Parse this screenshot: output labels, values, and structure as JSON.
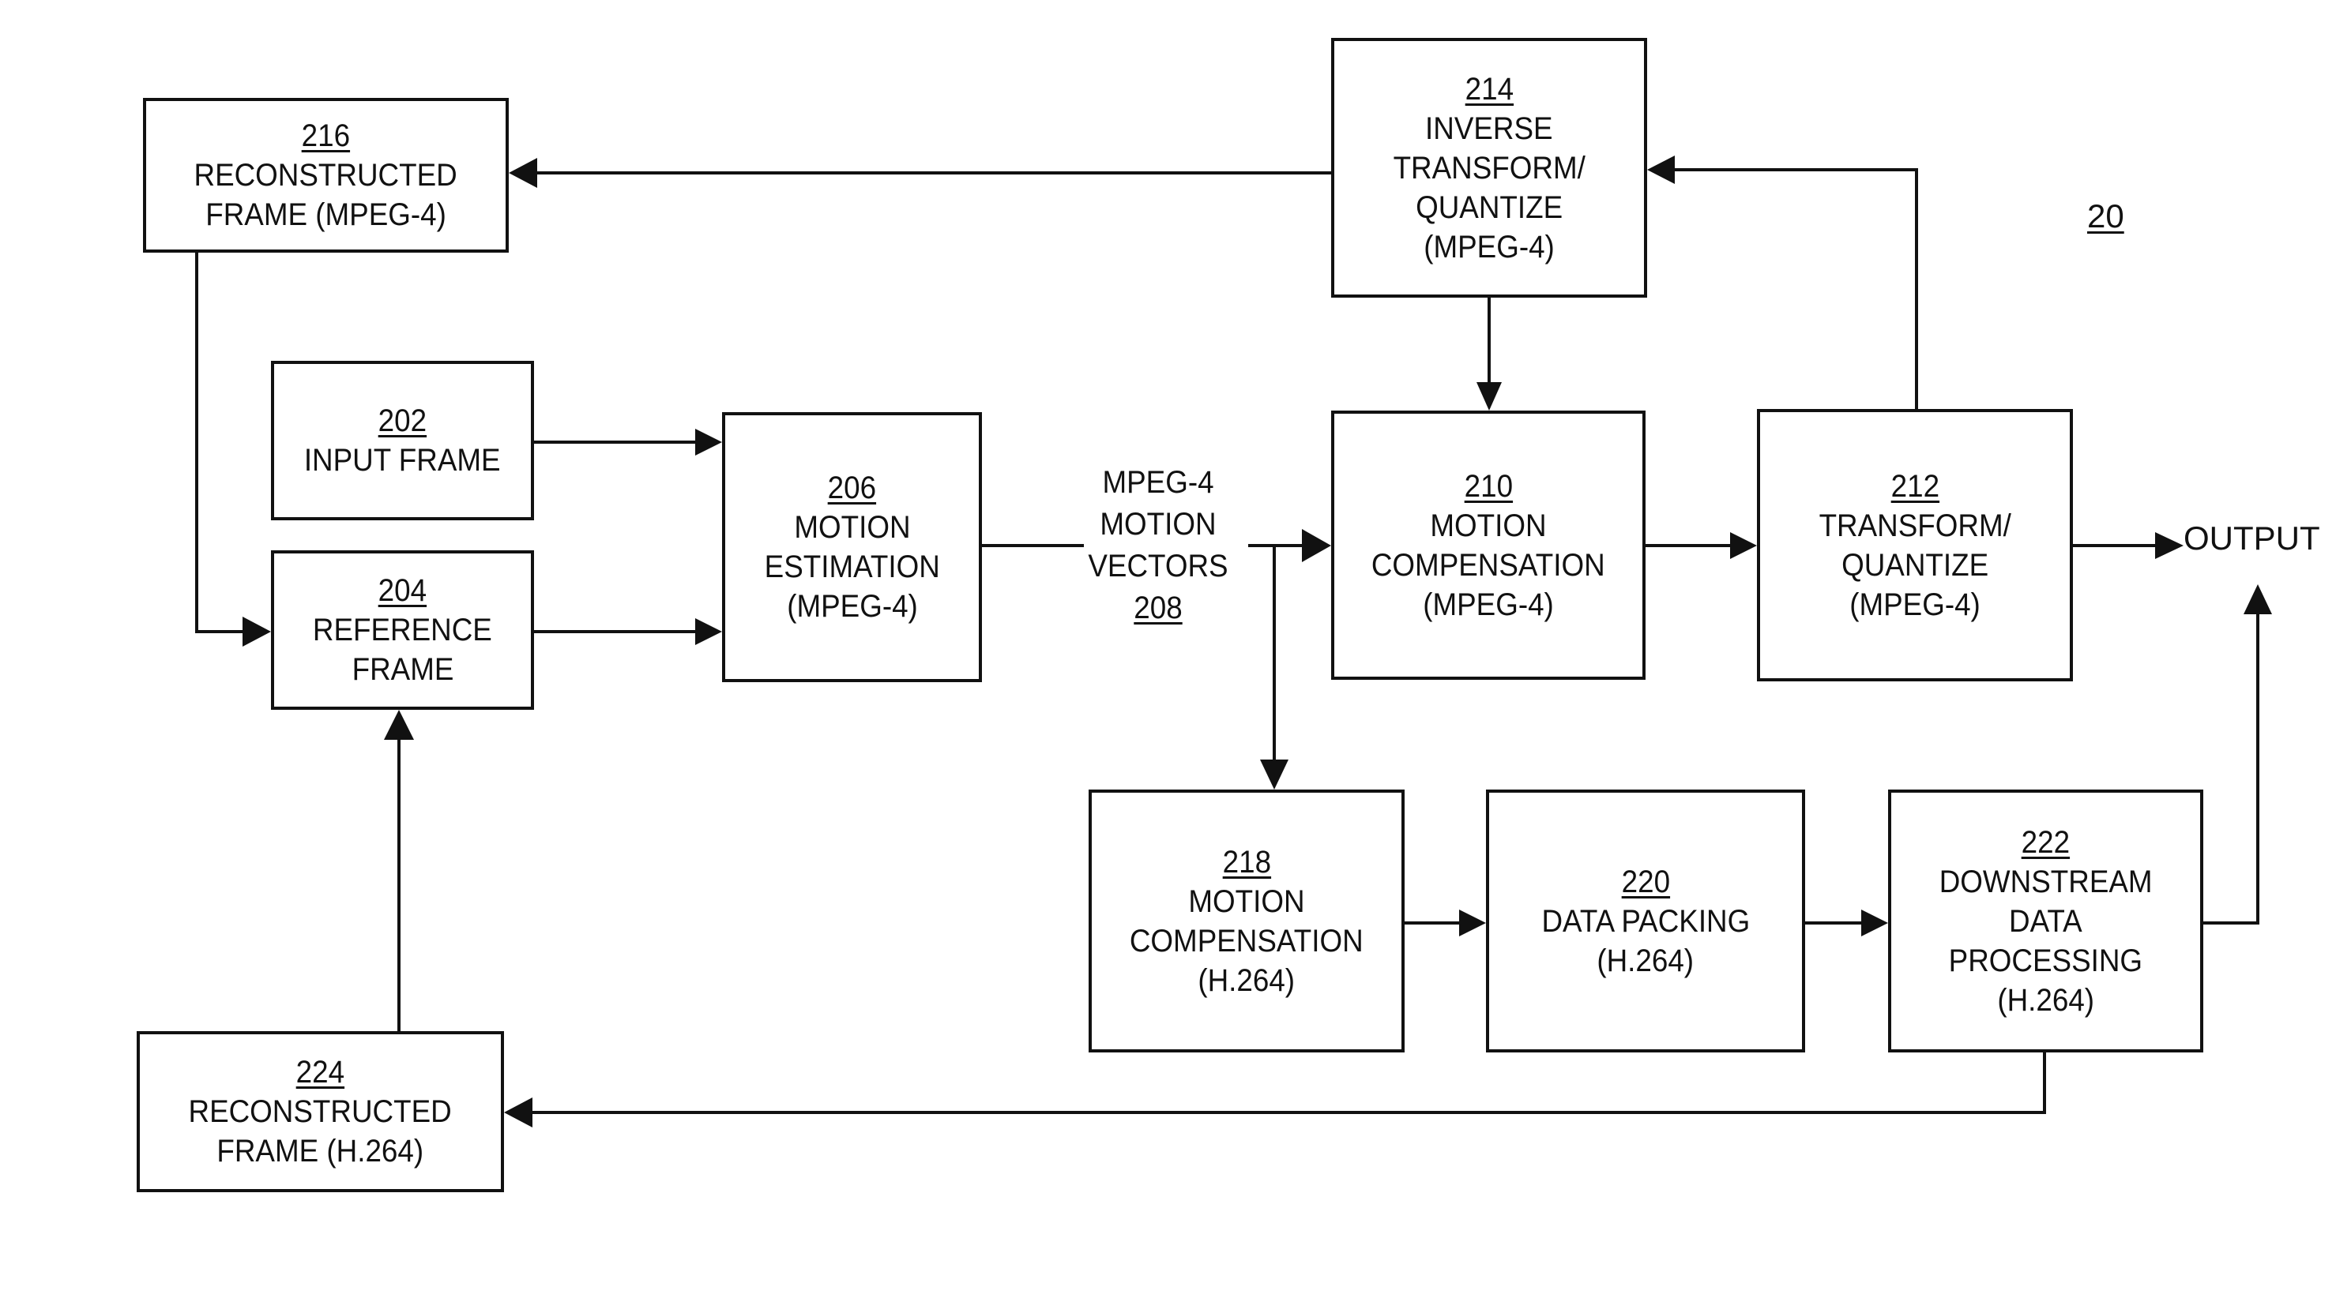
{
  "figure": {
    "figure_ref": "20",
    "output_label": "OUTPUT"
  },
  "blocks": {
    "b216": {
      "ref": "216",
      "lines": [
        "RECONSTRUCTED",
        "FRAME (MPEG-4)"
      ]
    },
    "b214": {
      "ref": "214",
      "lines": [
        "INVERSE",
        "TRANSFORM/",
        "QUANTIZE",
        "(MPEG-4)"
      ]
    },
    "b202": {
      "ref": "202",
      "lines": [
        "INPUT FRAME"
      ]
    },
    "b204": {
      "ref": "204",
      "lines": [
        "REFERENCE",
        "FRAME"
      ]
    },
    "b206": {
      "ref": "206",
      "lines": [
        "MOTION",
        "ESTIMATION",
        "(MPEG-4)"
      ]
    },
    "b210": {
      "ref": "210",
      "lines": [
        "MOTION",
        "COMPENSATION",
        "(MPEG-4)"
      ]
    },
    "b212": {
      "ref": "212",
      "lines": [
        "TRANSFORM/",
        "QUANTIZE",
        "(MPEG-4)"
      ]
    },
    "b218": {
      "ref": "218",
      "lines": [
        "MOTION",
        "COMPENSATION",
        "(H.264)"
      ]
    },
    "b220": {
      "ref": "220",
      "lines": [
        "DATA PACKING",
        "(H.264)"
      ]
    },
    "b222": {
      "ref": "222",
      "lines": [
        "DOWNSTREAM",
        "DATA",
        "PROCESSING",
        "(H.264)"
      ]
    },
    "b224": {
      "ref": "224",
      "lines": [
        "RECONSTRUCTED",
        "FRAME (H.264)"
      ]
    }
  },
  "signals": {
    "s208": {
      "lines": [
        "MPEG-4",
        "MOTION",
        "VECTORS"
      ],
      "ref": "208"
    }
  },
  "connections": [
    {
      "from": "202",
      "to": "206"
    },
    {
      "from": "204",
      "to": "206"
    },
    {
      "from": "206",
      "to": "210",
      "label": "208"
    },
    {
      "from": "208",
      "to": "218"
    },
    {
      "from": "210",
      "to": "212"
    },
    {
      "from": "212",
      "to": "OUTPUT"
    },
    {
      "from": "212",
      "to": "214"
    },
    {
      "from": "214",
      "to": "210"
    },
    {
      "from": "214",
      "to": "216"
    },
    {
      "from": "216",
      "to": "204"
    },
    {
      "from": "218",
      "to": "220"
    },
    {
      "from": "220",
      "to": "222"
    },
    {
      "from": "222",
      "to": "OUTPUT"
    },
    {
      "from": "222",
      "to": "224"
    },
    {
      "from": "224",
      "to": "204"
    }
  ]
}
